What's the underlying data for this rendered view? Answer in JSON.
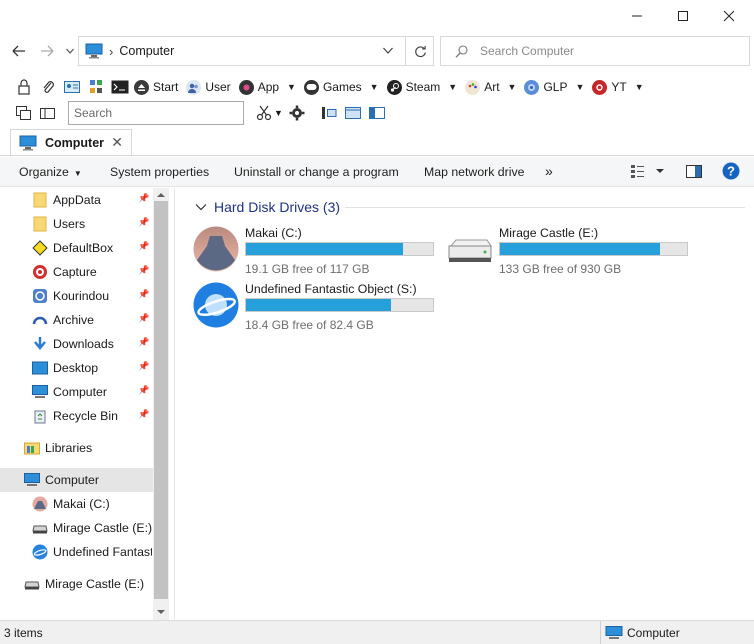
{
  "window": {
    "minimize": "—",
    "maximize": "☐",
    "close": "✕"
  },
  "nav": {
    "location": "Computer",
    "search_placeholder": "Search Computer"
  },
  "toolbar1": {
    "items": [
      "Start",
      "User",
      "App",
      "Games",
      "Steam",
      "Art",
      "GLP",
      "YT"
    ]
  },
  "toolbar2": {
    "search_placeholder": "Search"
  },
  "tab": {
    "label": "Computer",
    "close": "✕"
  },
  "commands": {
    "organize": "Organize",
    "system_properties": "System properties",
    "uninstall": "Uninstall or change a program",
    "map_drive": "Map network drive",
    "more": "»"
  },
  "sidebar": {
    "quick_access": [
      "AppData",
      "Users",
      "DefaultBox",
      "Capture",
      "Kourindou",
      "Archive",
      "Downloads",
      "Desktop",
      "Computer",
      "Recycle Bin"
    ],
    "libraries": "Libraries",
    "computer": "Computer",
    "drives": [
      "Makai (C:)",
      "Mirage Castle (E:)",
      "Undefined Fantasti"
    ],
    "network_drive": "Mirage Castle (E:)"
  },
  "main": {
    "group_title": "Hard Disk Drives (3)",
    "drives": [
      {
        "name": "Makai (C:)",
        "free_text": "19.1 GB free of 117 GB",
        "used_fraction": 0.837
      },
      {
        "name": "Mirage Castle (E:)",
        "free_text": "133 GB free of 930 GB",
        "used_fraction": 0.857
      },
      {
        "name": "Undefined Fantastic Object (S:)",
        "free_text": "18.4 GB free of 82.4 GB",
        "used_fraction": 0.777
      }
    ]
  },
  "status": {
    "count": "3 items",
    "location": "Computer"
  },
  "colors": {
    "accent": "#26a0da",
    "group_title": "#1e3287",
    "help": "#1565c0"
  }
}
